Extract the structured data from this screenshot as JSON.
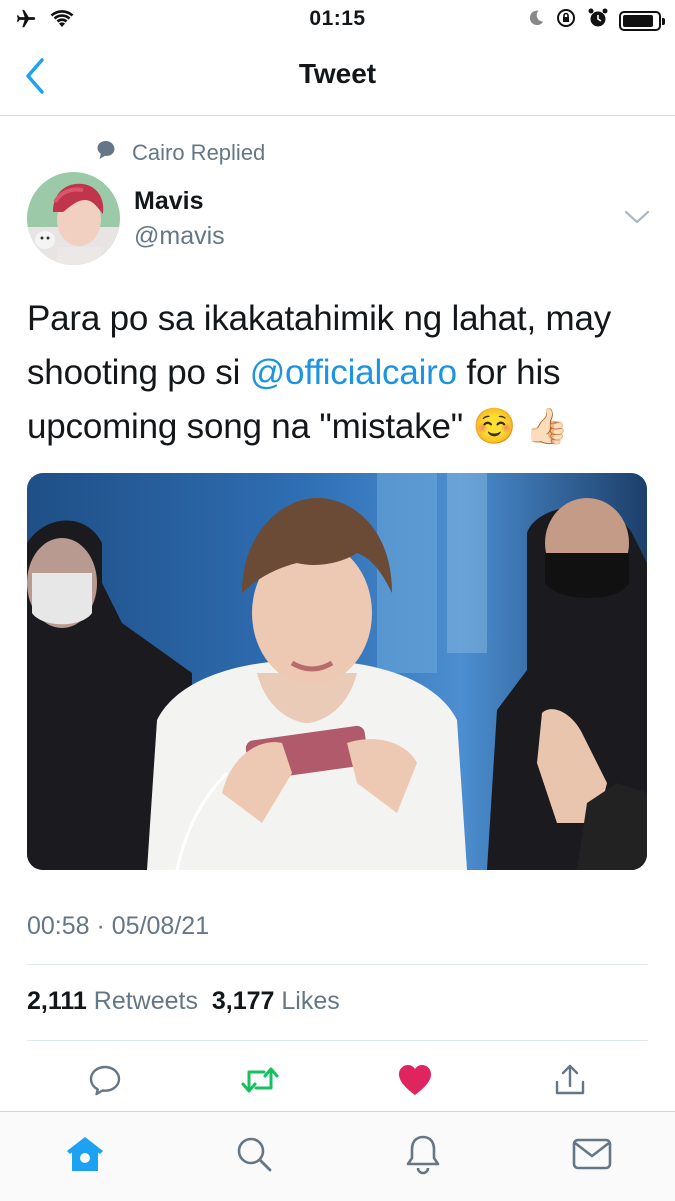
{
  "status_bar": {
    "time": "01:15",
    "icons": [
      "airplane-icon",
      "wifi-icon",
      "moon-icon",
      "orientation-lock-icon",
      "alarm-icon",
      "battery-icon"
    ]
  },
  "nav": {
    "title": "Tweet",
    "back_icon": "chevron-left-icon"
  },
  "tweet": {
    "context": "Cairo Replied",
    "author_name": "Mavis",
    "author_handle": "@mavis",
    "text_before": "Para po sa ikakatahimik ng lahat, may shooting po si ",
    "mention": "@officialcairo",
    "text_after": " for his upcoming song na \"mistake\" ☺️ 👍🏻",
    "timestamp": "00:58 · 05/08/21",
    "retweets_count": "2,111",
    "retweets_label": "Retweets",
    "likes_count": "3,177",
    "likes_label": "Likes",
    "liked": true
  },
  "actions": [
    "reply-icon",
    "retweet-icon",
    "like-icon",
    "share-icon"
  ],
  "tabbar": [
    "home-icon",
    "search-icon",
    "notifications-icon",
    "messages-icon"
  ],
  "colors": {
    "accent": "#1da1f2",
    "link": "#1b95e0",
    "retweet": "#17bf63",
    "like": "#e0245e",
    "secondary_text": "#657786"
  }
}
